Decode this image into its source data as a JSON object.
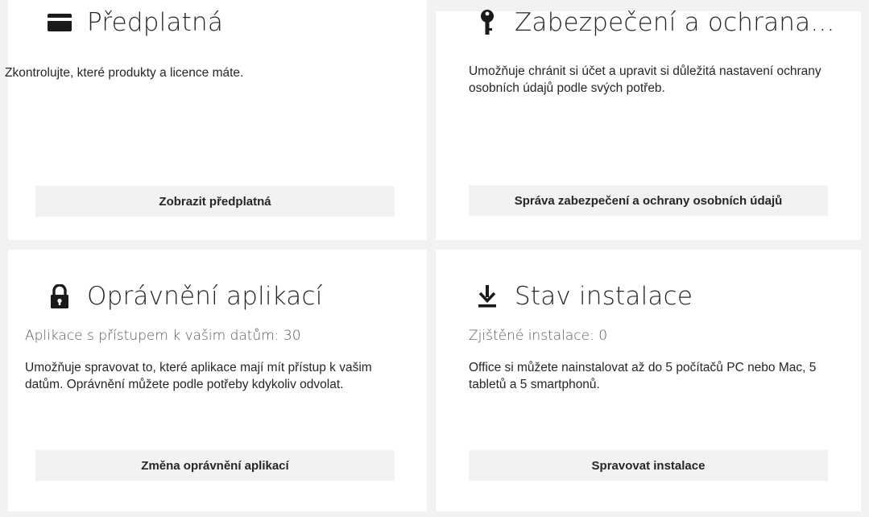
{
  "cards": {
    "subscriptions": {
      "icon": "credit-card-icon",
      "title": "Předplatná",
      "description": "Zkontrolujte, které produkty a licence máte.",
      "button_label": "Zobrazit předplatná"
    },
    "security": {
      "icon": "key-icon",
      "title": "Zabezpečení a ochrana...",
      "description": "Umožňuje chránit si účet a upravit si důležitá nastavení ochrany osobních údajů podle svých potřeb.",
      "button_label": "Správa zabezpečení a ochrany osobních údajů"
    },
    "app_permissions": {
      "icon": "lock-icon",
      "title": "Oprávnění aplikací",
      "subtitle": "Aplikace s přístupem k vašim datům: 30",
      "description": "Umožňuje spravovat to, které aplikace mají mít přístup k vašim datům. Oprávnění můžete podle potřeby kdykoliv odvolat.",
      "button_label": "Změna oprávnění aplikací"
    },
    "install_status": {
      "icon": "download-icon",
      "title": "Stav instalace",
      "subtitle": "Zjištěné instalace: 0",
      "description": "Office si můžete nainstalovat až do 5 počítačů PC nebo Mac, 5 tabletů a 5 smartphonů.",
      "button_label": "Spravovat instalace"
    }
  },
  "colors": {
    "page_background": "#f2f2f2",
    "card_background": "#ffffff",
    "button_background": "#f2f2f2",
    "text": "#262626",
    "subtitle_text": "#5b5b5b"
  }
}
